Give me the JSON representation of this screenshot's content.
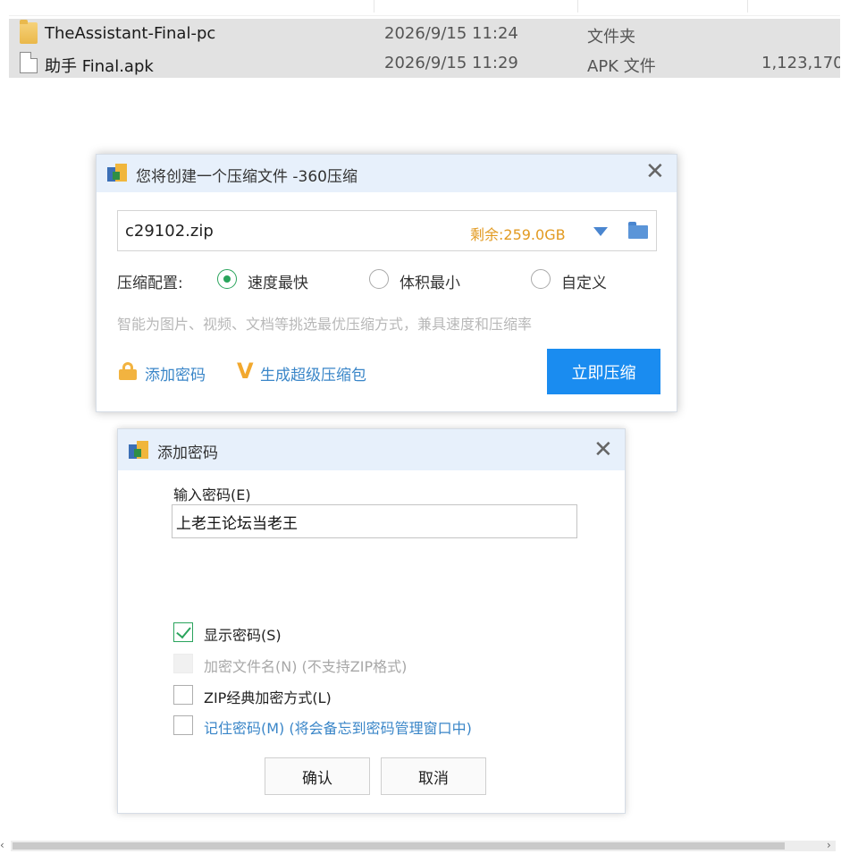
{
  "explorer": {
    "files": [
      {
        "icon": "folder-icon",
        "name": "TheAssistant-Final-pc",
        "modified": "2026/9/15 11:24",
        "type": "文件夹",
        "size": ""
      },
      {
        "icon": "file-icon",
        "name": "助手 Final.apk",
        "modified": "2026/9/15 11:29",
        "type": "APK 文件",
        "size": "1,123,170,"
      }
    ],
    "scroll_left": "‹",
    "scroll_right": "›"
  },
  "zip_dialog": {
    "title": "您将创建一个压缩文件 -360压缩",
    "close": "✕",
    "filename": "c29102.zip",
    "remaining_space": "剩余:259.0GB",
    "config_label": "压缩配置:",
    "options": [
      {
        "label": "速度最快",
        "selected": true
      },
      {
        "label": "体积最小",
        "selected": false
      },
      {
        "label": "自定义",
        "selected": false
      }
    ],
    "hint": "智能为图片、视频、文档等挑选最优压缩方式，兼具速度和压缩率",
    "add_password": "添加密码",
    "super_package_icon": "V",
    "super_package": "生成超级压缩包",
    "compress_now": "立即压缩"
  },
  "password_dialog": {
    "title": "添加密码",
    "close": "✕",
    "input_label": "输入密码(E)",
    "password_value": "上老王论坛当老王",
    "checks": [
      {
        "label": "显示密码(S)",
        "checked": true,
        "disabled": false,
        "style": "normal"
      },
      {
        "label": "加密文件名(N) (不支持ZIP格式)",
        "checked": false,
        "disabled": true,
        "style": "disabled"
      },
      {
        "label": "ZIP经典加密方式(L)",
        "checked": false,
        "disabled": false,
        "style": "normal"
      },
      {
        "label": "记住密码(M) (将会备忘到密码管理窗口中)",
        "checked": false,
        "disabled": false,
        "style": "blue"
      }
    ],
    "ok": "确认",
    "cancel": "取消"
  },
  "colors": {
    "accent_blue": "#1a8cf0",
    "link_blue": "#3a86c8",
    "check_green": "#2aa45c",
    "remaining_orange": "#e29a21",
    "titlebar_bg": "#e7f0fb"
  }
}
